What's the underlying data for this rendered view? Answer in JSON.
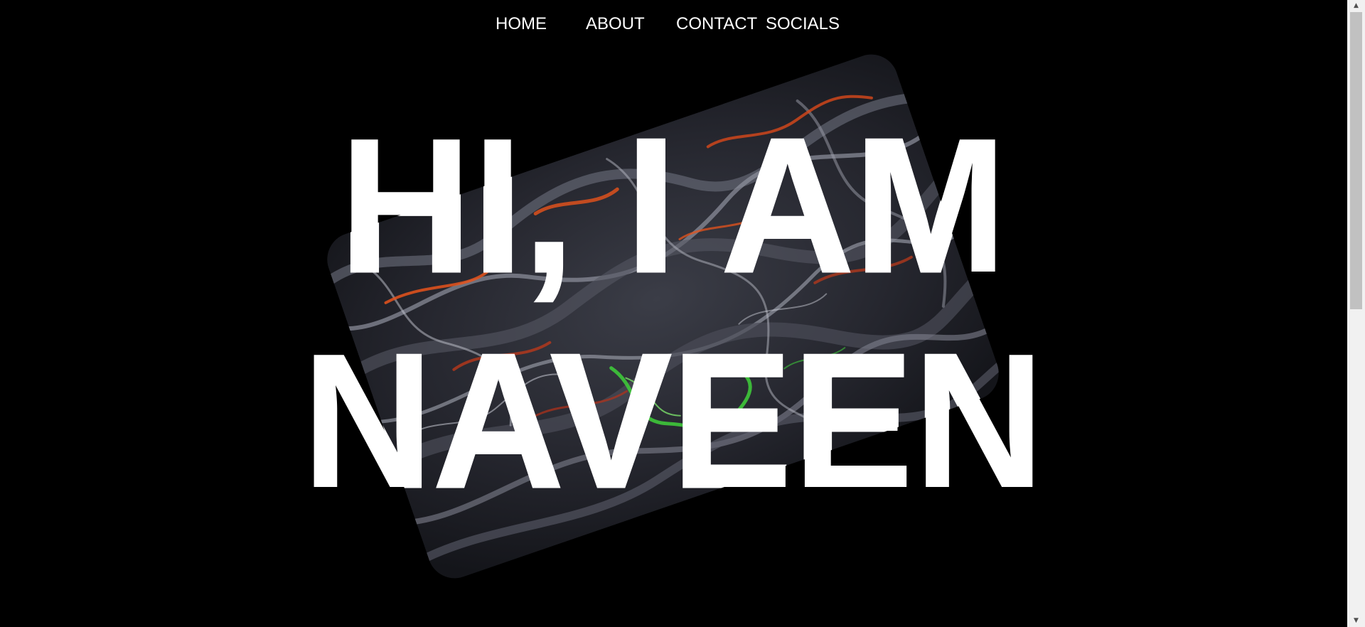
{
  "nav": {
    "home": "HOME",
    "about": "ABOUT",
    "contact": "CONTACT",
    "socials": "SOCIALS"
  },
  "hero": {
    "line1": "HI, I AM",
    "line2": "NAVEEN"
  },
  "colors": {
    "background": "#000000",
    "text": "#ffffff",
    "card_base": "#2a2b33",
    "accent_orange": "#e8541c",
    "accent_green": "#3ec83a"
  },
  "scrollbar": {
    "up_icon": "triangle-up-icon",
    "down_icon": "triangle-down-icon"
  }
}
